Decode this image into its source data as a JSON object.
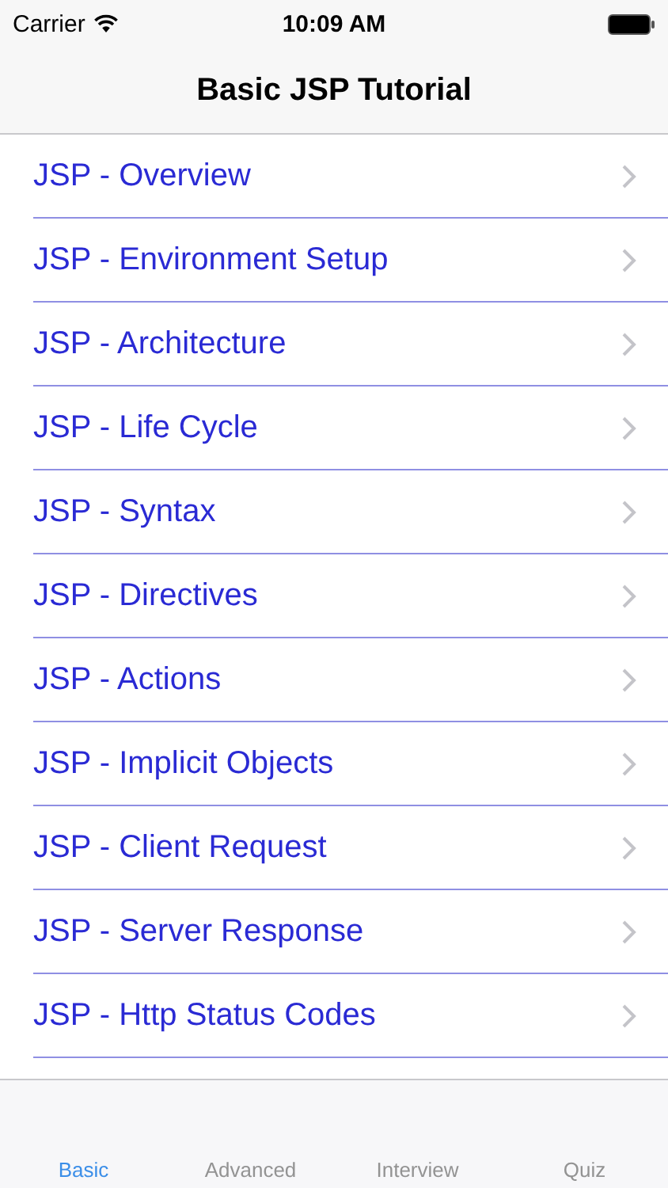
{
  "status_bar": {
    "carrier": "Carrier",
    "time": "10:09 AM"
  },
  "nav": {
    "title": "Basic JSP Tutorial"
  },
  "items": [
    {
      "label": "JSP - Overview"
    },
    {
      "label": "JSP - Environment Setup"
    },
    {
      "label": "JSP - Architecture"
    },
    {
      "label": "JSP - Life Cycle"
    },
    {
      "label": "JSP - Syntax"
    },
    {
      "label": "JSP - Directives"
    },
    {
      "label": "JSP - Actions"
    },
    {
      "label": "JSP - Implicit Objects"
    },
    {
      "label": "JSP - Client Request"
    },
    {
      "label": "JSP - Server Response"
    },
    {
      "label": "JSP - Http Status Codes"
    }
  ],
  "tabs": [
    {
      "label": "Basic",
      "selected": true
    },
    {
      "label": "Advanced",
      "selected": false
    },
    {
      "label": "Interview",
      "selected": false
    },
    {
      "label": "Quiz",
      "selected": false
    }
  ]
}
